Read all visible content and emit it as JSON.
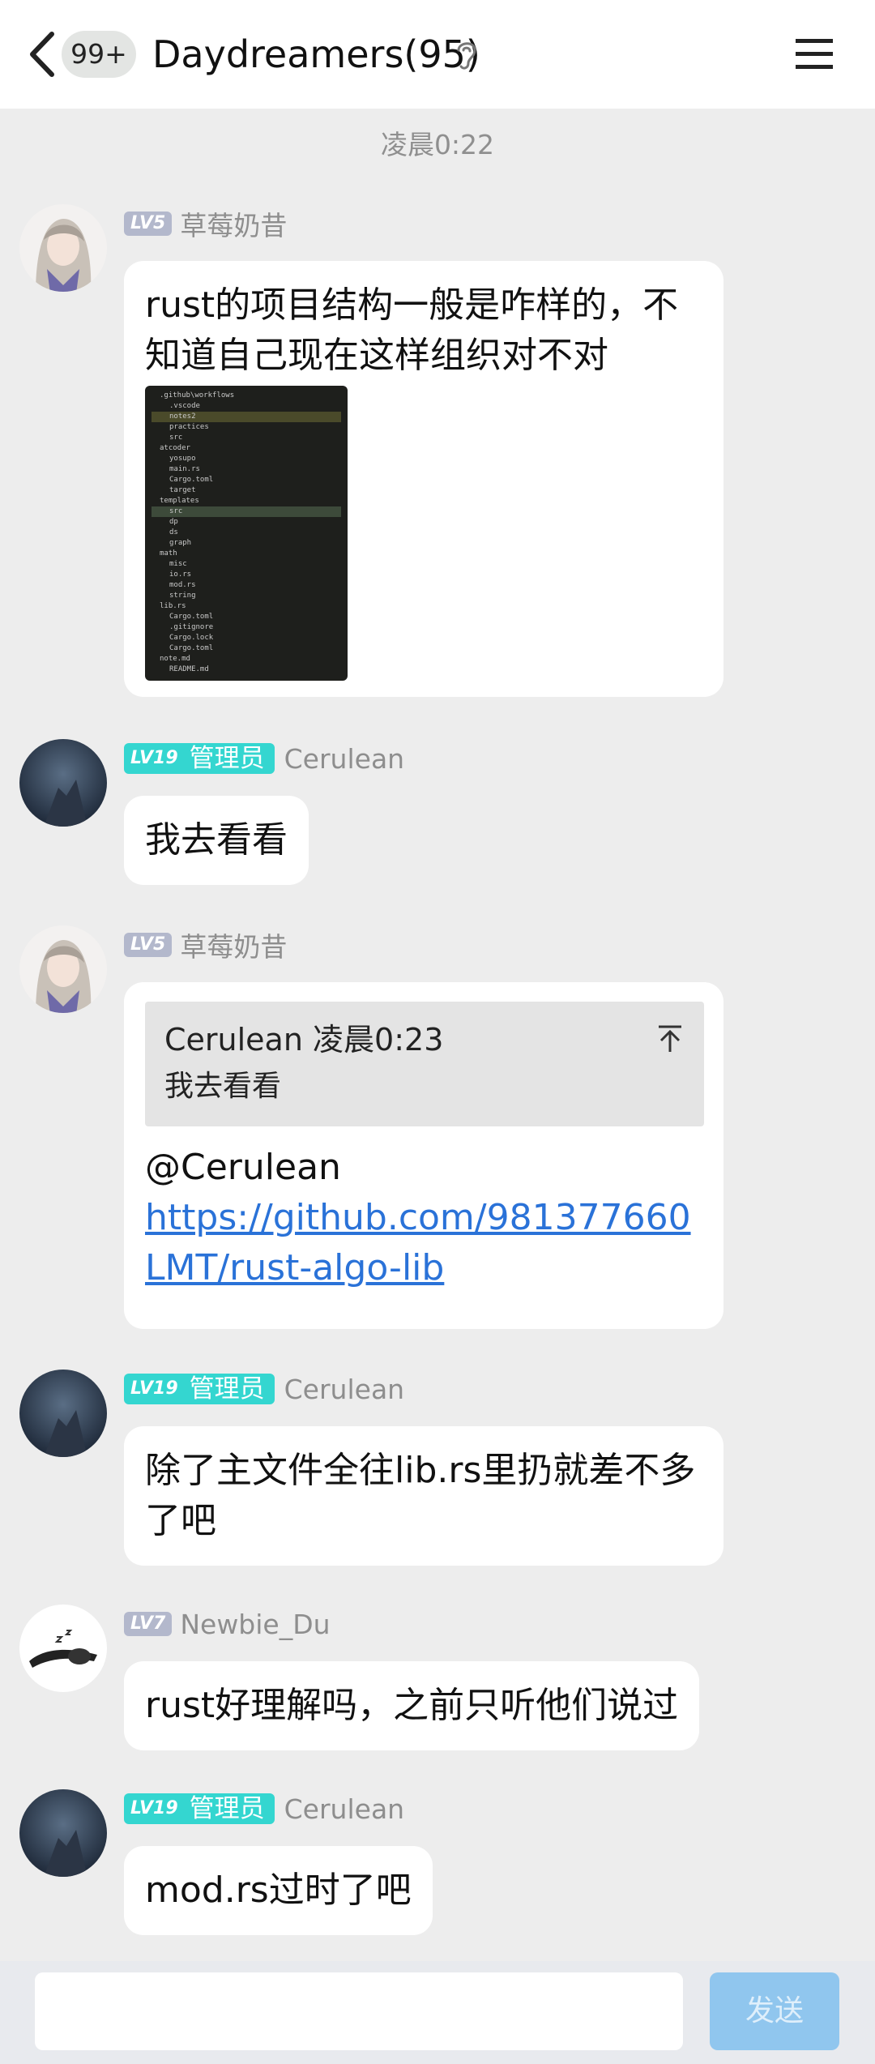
{
  "header": {
    "unread_badge": "99+",
    "title": "Daydreamers(95)"
  },
  "time_separator": "凌晨0:22",
  "messages": [
    {
      "level": "LV5",
      "sender": "草莓奶昔",
      "text": "rust的项目结构一般是咋样的，不知道自己现在这样组织对不对",
      "image_lines": [
        ".github\\workflows",
        ".vscode",
        "notes2",
        "practices",
        "src",
        "atcoder",
        "yosupo",
        "main.rs",
        "Cargo.toml",
        "target",
        "templates",
        "src",
        "dp",
        "ds",
        "graph",
        "math",
        "misc",
        "io.rs",
        "mod.rs",
        "string",
        "lib.rs",
        "Cargo.toml",
        ".gitignore",
        "Cargo.lock",
        "Cargo.toml",
        "note.md",
        "README.md"
      ]
    },
    {
      "level": "LV19",
      "role": "管理员",
      "sender": "Cerulean",
      "text": "我去看看"
    },
    {
      "level": "LV5",
      "sender": "草莓奶昔",
      "quote_author": "Cerulean",
      "quote_time": "凌晨0:23",
      "quote_text": "我去看看",
      "mention": "@Cerulean",
      "link": "https://github.com/981377660LMT/rust-algo-lib"
    },
    {
      "level": "LV19",
      "role": "管理员",
      "sender": "Cerulean",
      "text": "除了主文件全往lib.rs里扔就差不多了吧"
    },
    {
      "level": "LV7",
      "sender": "Newbie_Du",
      "text": "rust好理解吗，之前只听他们说过"
    },
    {
      "level": "LV19",
      "role": "管理员",
      "sender": "Cerulean",
      "text": "mod.rs过时了吧"
    }
  ],
  "input": {
    "send_label": "发送"
  },
  "colors": {
    "background": "#ededed",
    "bubble": "#ffffff",
    "admin_badge": "#34d6d0",
    "level_badge": "#b3b8cc",
    "link": "#2a72d8",
    "send_button": "#90c6ee"
  }
}
